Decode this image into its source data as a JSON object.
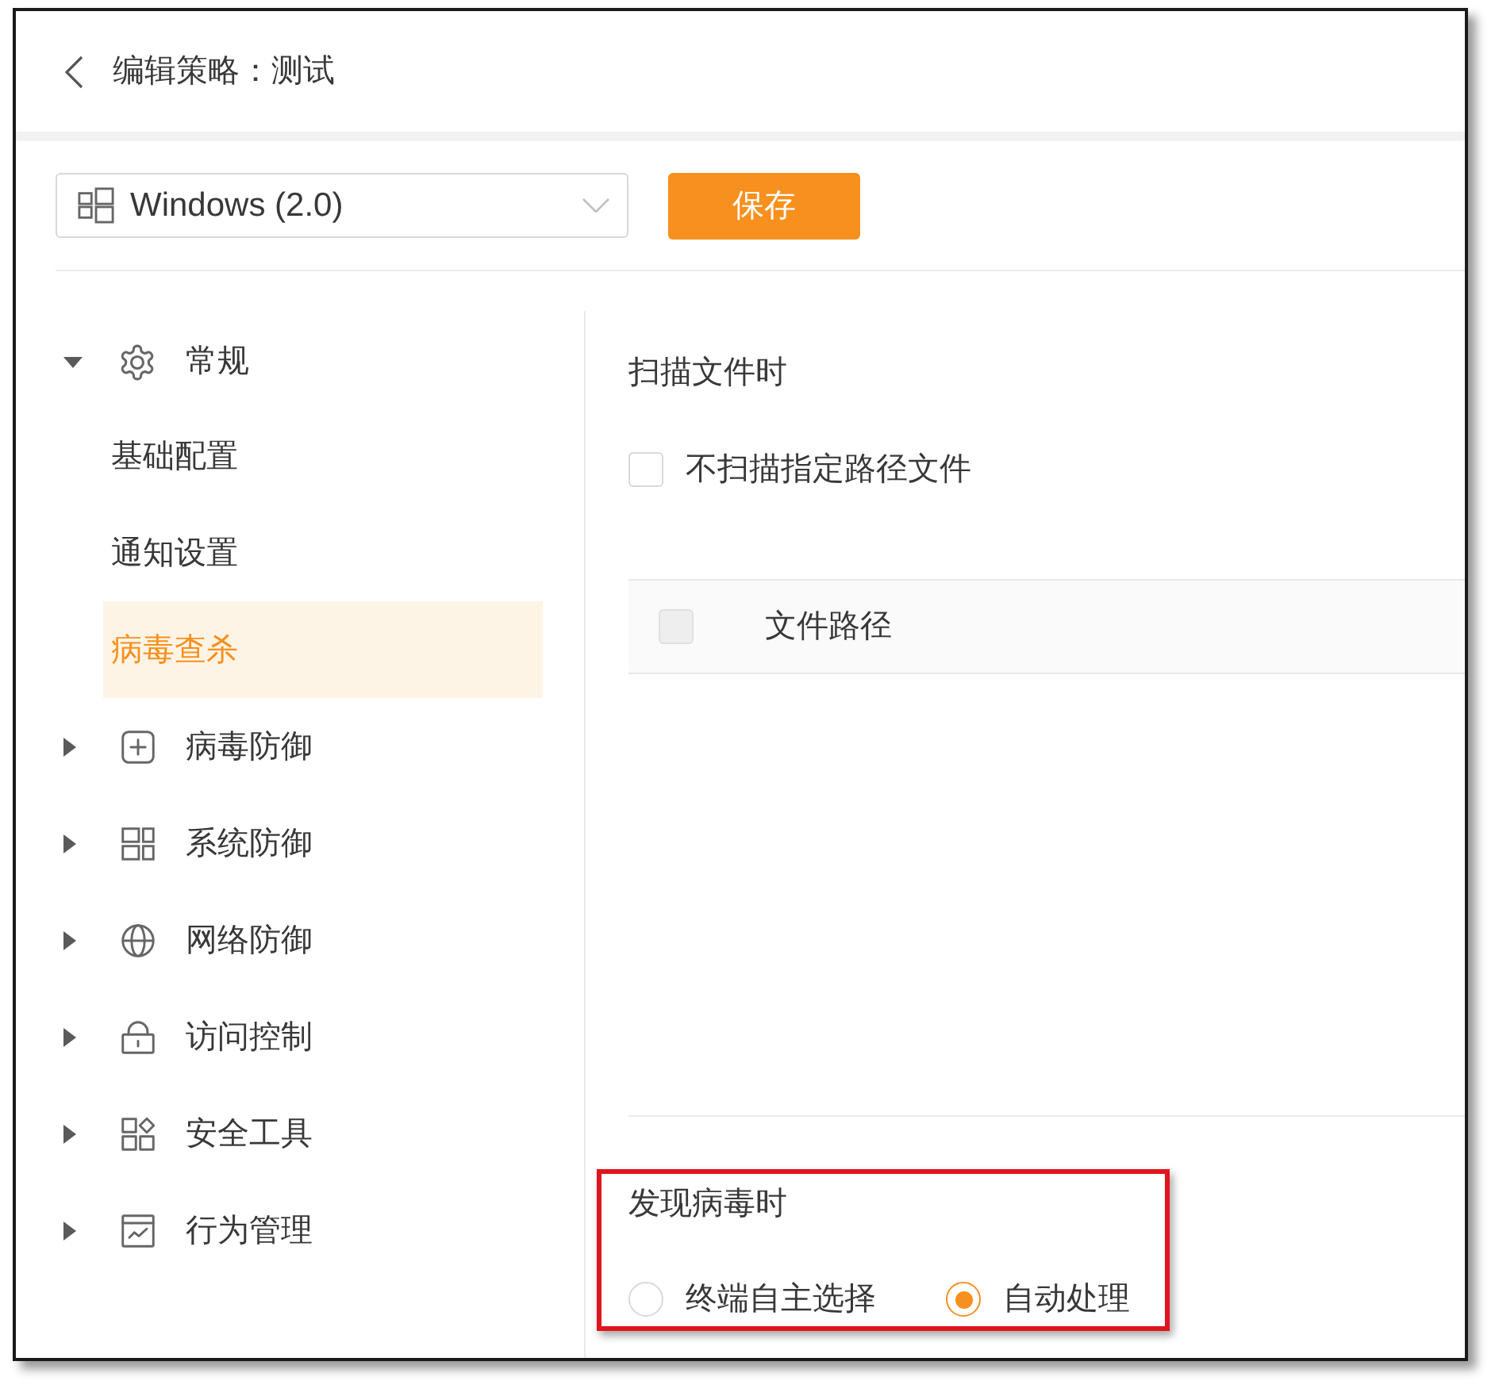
{
  "header": {
    "title": "编辑策略：测试"
  },
  "toolbar": {
    "platform": {
      "value": "Windows (2.0)"
    },
    "save_button": {
      "label": "保存"
    }
  },
  "sidebar": {
    "items": [
      {
        "label": "常规",
        "expanded": true,
        "children": [
          {
            "label": "基础配置",
            "selected": false
          },
          {
            "label": "通知设置",
            "selected": false
          },
          {
            "label": "病毒查杀",
            "selected": true
          }
        ]
      },
      {
        "label": "病毒防御",
        "expanded": false
      },
      {
        "label": "系统防御",
        "expanded": false
      },
      {
        "label": "网络防御",
        "expanded": false
      },
      {
        "label": "访问控制",
        "expanded": false
      },
      {
        "label": "安全工具",
        "expanded": false
      },
      {
        "label": "行为管理",
        "expanded": false
      }
    ]
  },
  "scan_files": {
    "title": "扫描文件时",
    "exclude_paths": {
      "label": "不扫描指定路径文件",
      "checked": false
    },
    "table": {
      "select_all": {
        "checked": false,
        "disabled": true
      },
      "columns": [
        {
          "label": "文件路径"
        }
      ]
    }
  },
  "virus_found": {
    "title": "发现病毒时",
    "highlighted": true,
    "options": [
      {
        "label": "终端自主选择",
        "selected": false
      },
      {
        "label": "自动处理",
        "selected": true
      }
    ]
  }
}
